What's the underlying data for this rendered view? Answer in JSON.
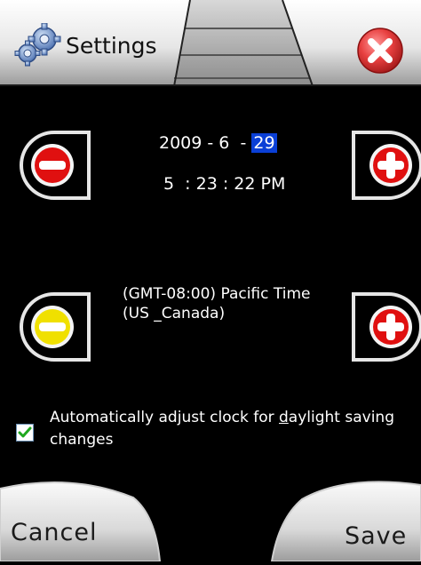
{
  "header": {
    "title": "Settings",
    "close_label": "Close"
  },
  "datetime": {
    "year": "2009",
    "sep1": " - ",
    "month": "6",
    "sep2": "  - ",
    "day": "29",
    "hour": "5",
    "sep3": "  : ",
    "minute": "23",
    "sep4": " : ",
    "second": "22",
    "ampm": "PM"
  },
  "timezone": {
    "label": "(GMT-08:00) Pacific Time (US _Canada)"
  },
  "dst": {
    "checked": true,
    "label": "Automatically adjust clock for daylight saving changes"
  },
  "buttons": {
    "cancel": "Cancel",
    "save": "Save"
  },
  "colors": {
    "minus_date": "#e01010",
    "minus_tz": "#f0e000",
    "plus": "#e01010",
    "selection": "#0a3fd6"
  }
}
